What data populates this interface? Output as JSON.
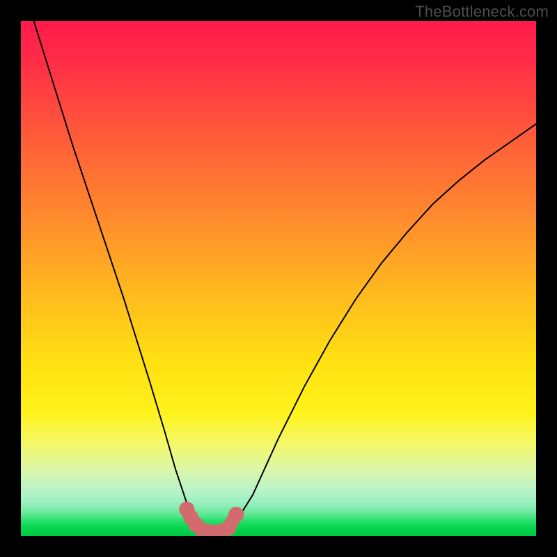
{
  "watermark": "TheBottleneck.com",
  "chart_data": {
    "type": "line",
    "title": "",
    "xlabel": "",
    "ylabel": "",
    "xlim": [
      0,
      100
    ],
    "ylim": [
      0,
      100
    ],
    "series": [
      {
        "name": "bottleneck-curve",
        "x": [
          0,
          5,
          10,
          15,
          20,
          25,
          28,
          30,
          32,
          33.5,
          35,
          36.5,
          38,
          40,
          42,
          45,
          50,
          55,
          60,
          65,
          70,
          75,
          80,
          85,
          90,
          95,
          100
        ],
        "y": [
          108,
          92,
          76,
          61,
          46,
          30,
          20,
          13,
          7,
          3.5,
          1.5,
          0.6,
          0.6,
          1.2,
          3.2,
          8,
          19,
          29,
          38,
          46,
          53,
          59,
          64.5,
          69,
          73,
          76.5,
          80
        ]
      }
    ],
    "highlight": {
      "name": "flat-minimum-band",
      "color": "#d36a6d",
      "x": [
        32.2,
        33.0,
        34.0,
        35.2,
        36.6,
        38.0,
        39.3,
        40.3,
        41.8
      ],
      "y": [
        5.2,
        3.6,
        2.2,
        1.2,
        0.8,
        0.8,
        1.0,
        1.6,
        4.2
      ]
    },
    "gradient_stops": [
      {
        "pos": 0.0,
        "color": "#ff1a4b"
      },
      {
        "pos": 0.22,
        "color": "#ff5a3a"
      },
      {
        "pos": 0.52,
        "color": "#ffb71f"
      },
      {
        "pos": 0.76,
        "color": "#fff21a"
      },
      {
        "pos": 0.91,
        "color": "#b9f3c8"
      },
      {
        "pos": 1.0,
        "color": "#00c843"
      }
    ]
  }
}
